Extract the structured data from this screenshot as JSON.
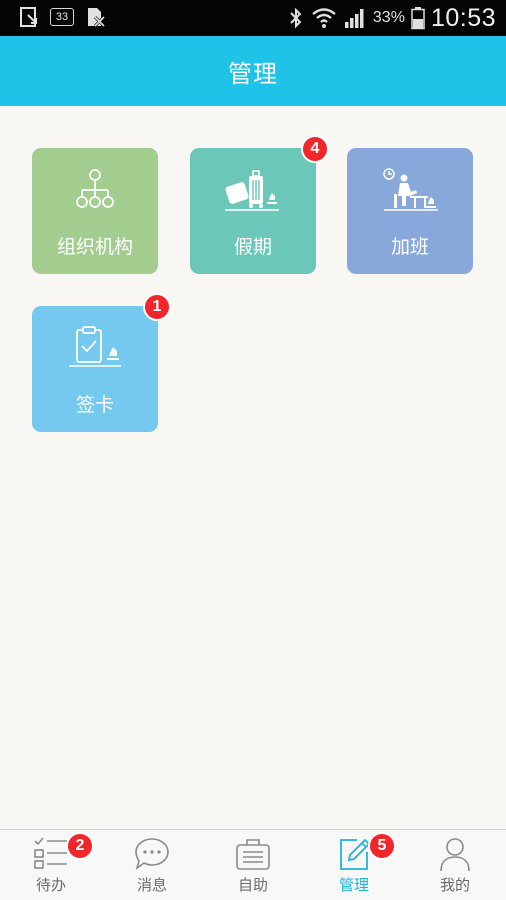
{
  "status_bar": {
    "notification_badge": "33",
    "battery_percent": "33%",
    "time": "10:53"
  },
  "header": {
    "title": "管理"
  },
  "tiles": [
    {
      "label": "组织机构",
      "color": "#a2cd8e",
      "icon": "org-chart-icon",
      "badge": ""
    },
    {
      "label": "假期",
      "color": "#6bc7b7",
      "icon": "luggage-icon",
      "badge": "4"
    },
    {
      "label": "加班",
      "color": "#88a8dc",
      "icon": "desk-worker-icon",
      "badge": ""
    },
    {
      "label": "签卡",
      "color": "#75c9ee",
      "icon": "clipboard-check-icon",
      "badge": "1"
    }
  ],
  "tabbar": {
    "items": [
      {
        "label": "待办",
        "icon": "todo-list-icon",
        "badge": "2",
        "active": false
      },
      {
        "label": "消息",
        "icon": "chat-bubble-icon",
        "badge": "",
        "active": false
      },
      {
        "label": "自助",
        "icon": "briefcase-icon",
        "badge": "",
        "active": false
      },
      {
        "label": "管理",
        "icon": "edit-icon",
        "badge": "5",
        "active": true
      },
      {
        "label": "我的",
        "icon": "person-icon",
        "badge": "",
        "active": false
      }
    ],
    "active_color": "#1fb3dc",
    "inactive_color": "#6b6b6b"
  }
}
